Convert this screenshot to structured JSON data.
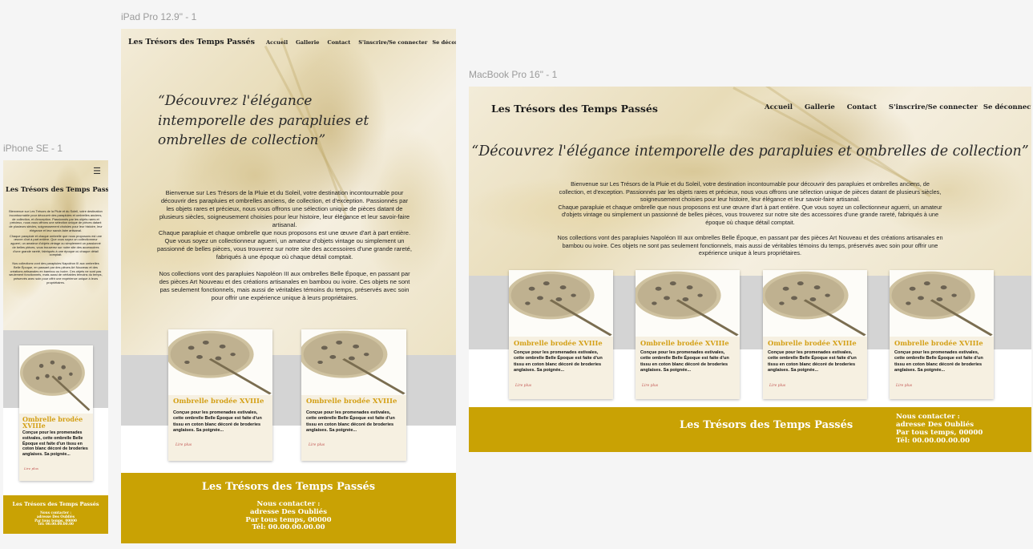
{
  "frames": {
    "iphone": {
      "label": "iPhone SE - 1"
    },
    "ipad": {
      "label": "iPad Pro 12.9\" - 1"
    },
    "macbook": {
      "label": "MacBook Pro 16\" - 1"
    }
  },
  "site": {
    "brand": "Les Trésors des Temps Passés",
    "nav": [
      "Accueil",
      "Gallerie",
      "Contact",
      "S'inscrire/Se connecter",
      "Se déconnecter"
    ],
    "menu_icon": "hamburger-icon",
    "tagline_open": "“Découvrez l'élégance intemporelle des parapluies et ombrelles de collection”",
    "intro_p1": "Bienvenue sur Les Trésors de la Pluie et du Soleil, votre destination incontournable pour découvrir des parapluies et ombrelles anciens, de collection, et d'exception. Passionnés par les objets rares et précieux, nous vous offrons une sélection unique de pièces datant de plusieurs siècles, soigneusement choisies pour leur histoire, leur élégance et leur savoir-faire artisanal.",
    "intro_p2": "Chaque parapluie et chaque ombrelle que nous proposons est une œuvre d'art à part entière. Que vous soyez un collectionneur aguerri, un amateur d'objets vintage ou simplement un passionné de belles pièces, vous trouverez sur notre site des accessoires d'une grande rareté, fabriqués à une époque où chaque détail comptait.",
    "intro_p3": "Nos collections vont des parapluies Napoléon III aux ombrelles Belle Époque, en passant par des pièces Art Nouveau et des créations artisanales en bambou ou ivoire. Ces objets ne sont pas seulement fonctionnels, mais aussi de véritables témoins du temps, préservés avec soin pour offrir une expérience unique à leurs propriétaires.",
    "card": {
      "title": "Ombrelle  brodée XVIIIe",
      "text": "Conçue pour les promenades estivales, cette ombrelle Belle Époque est faite d'un tissu en coton blanc décoré de broderies anglaises. Sa poignée...",
      "more": "Lire plus"
    },
    "footer": {
      "title": "Les Trésors des Temps Passés",
      "contact_heading": "Nous contacter :",
      "address": "adresse Des Oubliés",
      "city": "Par tous temps, 00000",
      "phone": "Tél: 00.00.00.00.00"
    }
  },
  "colors": {
    "accent": "#c9a204",
    "card_title": "#d4a017",
    "card_bg": "#f6f0e1",
    "band_gray": "#d4d4d4",
    "read_more": "#c0504d"
  }
}
